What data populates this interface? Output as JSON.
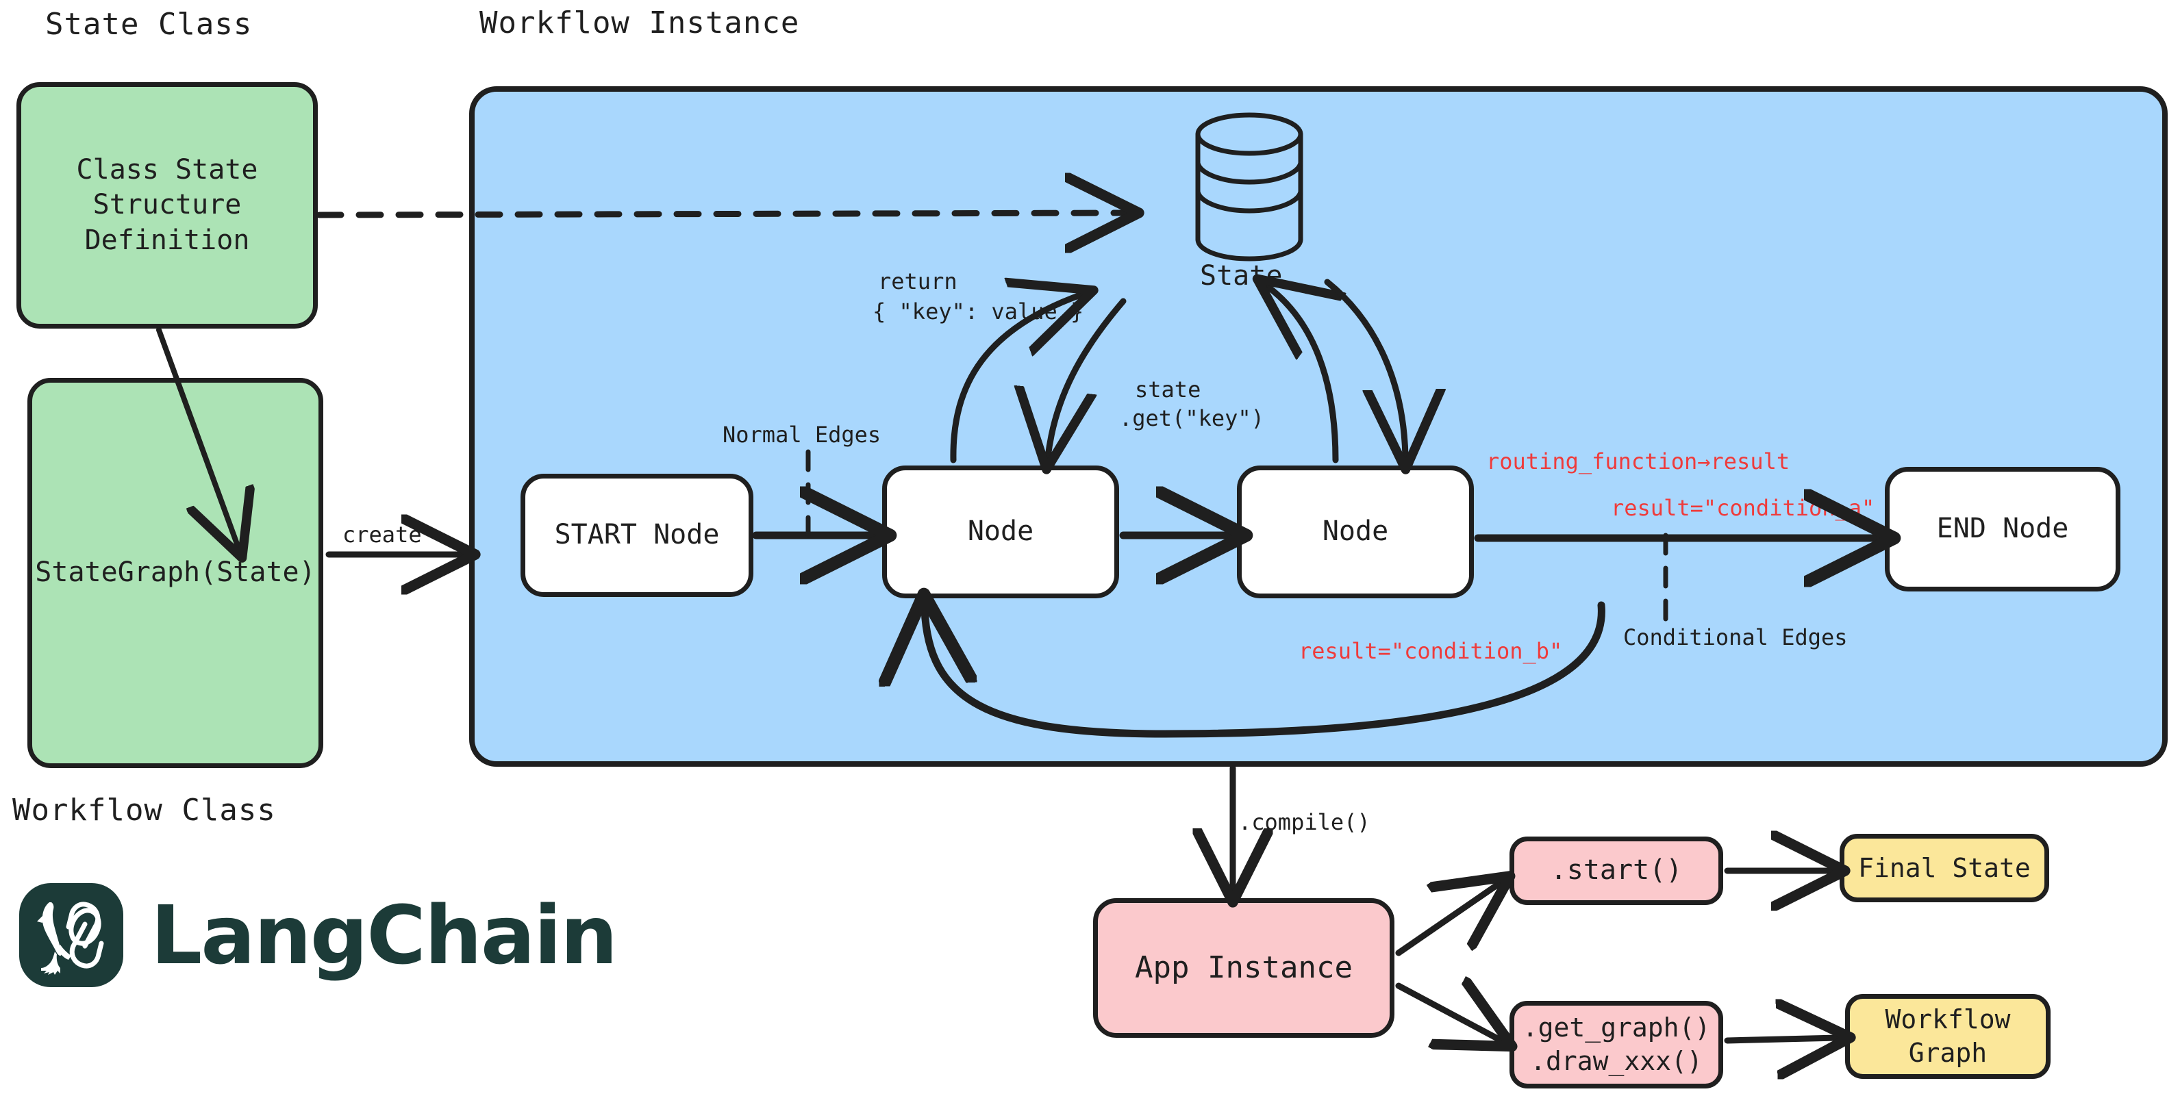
{
  "titles": {
    "state_class": "State Class",
    "workflow_instance": "Workflow Instance",
    "workflow_class": "Workflow Class"
  },
  "boxes": {
    "class_state": "Class State\nStructure\nDefinition",
    "state_graph": "StateGraph(State)",
    "start_node": "START Node",
    "node_1": "Node",
    "node_2": "Node",
    "end_node": "END Node",
    "app_instance": "App Instance",
    "start_method": ".start()",
    "graph_methods": ".get_graph()\n.draw_xxx()",
    "final_state": "Final State",
    "workflow_graph": "Workflow\nGraph"
  },
  "labels": {
    "create": "create",
    "state_store": "State",
    "return_line1": "return",
    "return_line2": "{ \"key\": value }",
    "state_get_line1": "state",
    "state_get_line2": ".get(\"key\")",
    "normal_edges": "Normal Edges",
    "conditional_edges": "Conditional Edges",
    "routing_function": "routing_function→result",
    "condition_a": "result=\"condition_a\"",
    "condition_b": "result=\"condition_b\"",
    "compile": ".compile()"
  },
  "logo": {
    "wordmark": "LangChain",
    "parrot_icon": "parrot-icon",
    "link_icon": "link-icon"
  },
  "colors": {
    "green": "#ace3b5",
    "blue": "#a9d7fd",
    "pink": "#fbc9cc",
    "yellow": "#fbe79a",
    "stroke": "#1f1f1f",
    "red_accent": "#ef3b3b",
    "logo_dark": "#1c3b38"
  }
}
